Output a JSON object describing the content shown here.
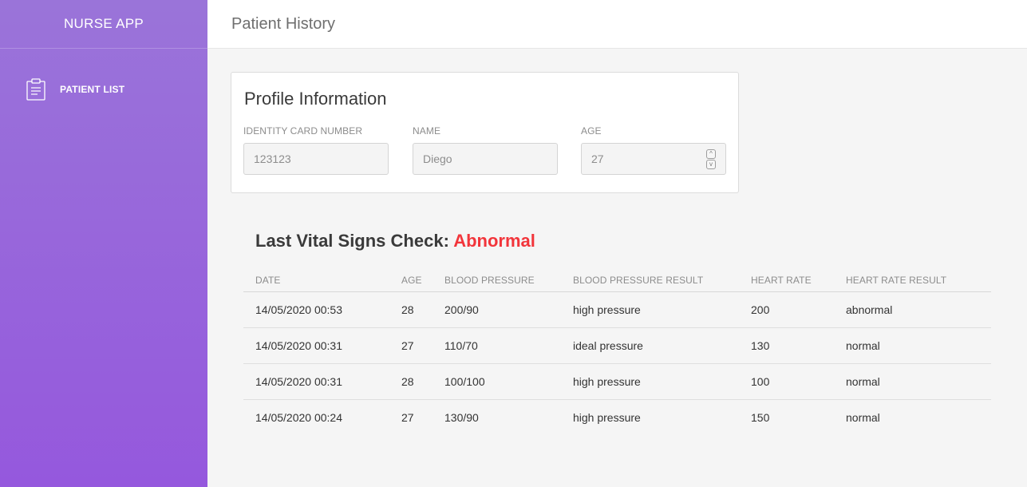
{
  "sidebar": {
    "brand": "NURSE APP",
    "items": [
      {
        "label": "PATIENT LIST",
        "icon": "clipboard-icon"
      }
    ]
  },
  "header": {
    "title": "Patient History"
  },
  "profile": {
    "title": "Profile Information",
    "identity_label": "IDENTITY CARD NUMBER",
    "identity_value": "123123",
    "name_label": "NAME",
    "name_value": "Diego",
    "age_label": "AGE",
    "age_value": "27"
  },
  "vitals": {
    "heading": "Last Vital Signs Check:",
    "status": "Abnormal",
    "status_color": "#f2353b",
    "columns": [
      "DATE",
      "AGE",
      "BLOOD PRESSURE",
      "BLOOD PRESSURE RESULT",
      "HEART RATE",
      "HEART RATE RESULT"
    ],
    "rows": [
      [
        "14/05/2020 00:53",
        "28",
        "200/90",
        "high pressure",
        "200",
        "abnormal"
      ],
      [
        "14/05/2020 00:31",
        "27",
        "110/70",
        "ideal pressure",
        "130",
        "normal"
      ],
      [
        "14/05/2020 00:31",
        "28",
        "100/100",
        "high pressure",
        "100",
        "normal"
      ],
      [
        "14/05/2020 00:24",
        "27",
        "130/90",
        "high pressure",
        "150",
        "normal"
      ]
    ]
  },
  "colors": {
    "sidebar_top": "#9a74d9",
    "sidebar_bottom": "#9558dd",
    "background": "#f5f5f5"
  }
}
